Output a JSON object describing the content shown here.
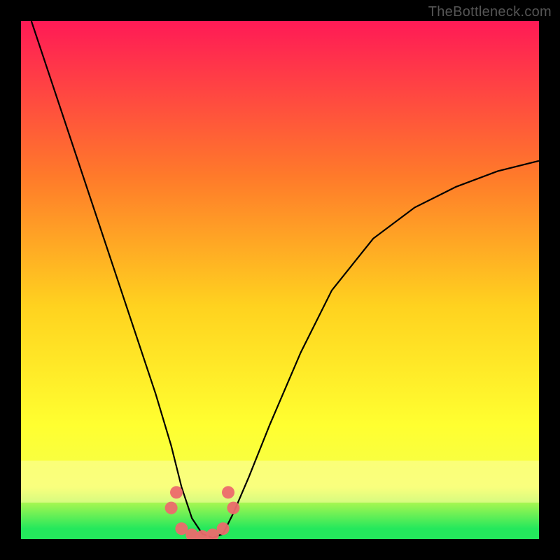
{
  "watermark": {
    "text": "TheBottleneck.com"
  },
  "colors": {
    "background": "#000000",
    "grad_top": "#ff1a56",
    "grad_mid1": "#ff7a2a",
    "grad_mid2": "#ffd21f",
    "grad_mid3": "#ffff30",
    "grad_band": "#f4ff4a",
    "grad_bottom": "#24e85c",
    "curve": "#000000",
    "marker": "#ec6a6d"
  },
  "chart_data": {
    "type": "line",
    "title": "",
    "xlabel": "",
    "ylabel": "",
    "xlim": [
      0,
      100
    ],
    "ylim": [
      0,
      100
    ],
    "grid": false,
    "legend": false,
    "series": [
      {
        "name": "bottleneck-curve",
        "x": [
          2,
          6,
          10,
          14,
          18,
          22,
          26,
          29,
          31,
          33,
          35,
          37,
          39,
          41,
          44,
          48,
          54,
          60,
          68,
          76,
          84,
          92,
          100
        ],
        "y": [
          100,
          88,
          76,
          64,
          52,
          40,
          28,
          18,
          10,
          4,
          1,
          0.2,
          1,
          5,
          12,
          22,
          36,
          48,
          58,
          64,
          68,
          71,
          73
        ]
      }
    ],
    "markers": {
      "name": "highlighted-points",
      "x": [
        29,
        31,
        33,
        35,
        37,
        39,
        41,
        30,
        40
      ],
      "y": [
        6,
        2,
        0.8,
        0.5,
        0.8,
        2,
        6,
        9,
        9
      ]
    }
  }
}
